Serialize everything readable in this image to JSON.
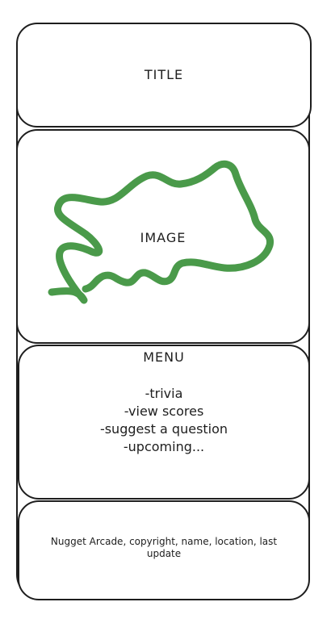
{
  "title_panel": {
    "label": "TITLE"
  },
  "image_panel": {
    "label": "IMAGE",
    "scribble_color": "#4a9a4a"
  },
  "menu_panel": {
    "heading": "MENU",
    "items": [
      "-trivia",
      "-view scores",
      "-suggest a question",
      "-upcoming..."
    ]
  },
  "footer_panel": {
    "text": "Nugget Arcade, copyright, name, location, last update"
  },
  "colors": {
    "stroke": "#1e1e1e",
    "background": "#ffffff"
  }
}
